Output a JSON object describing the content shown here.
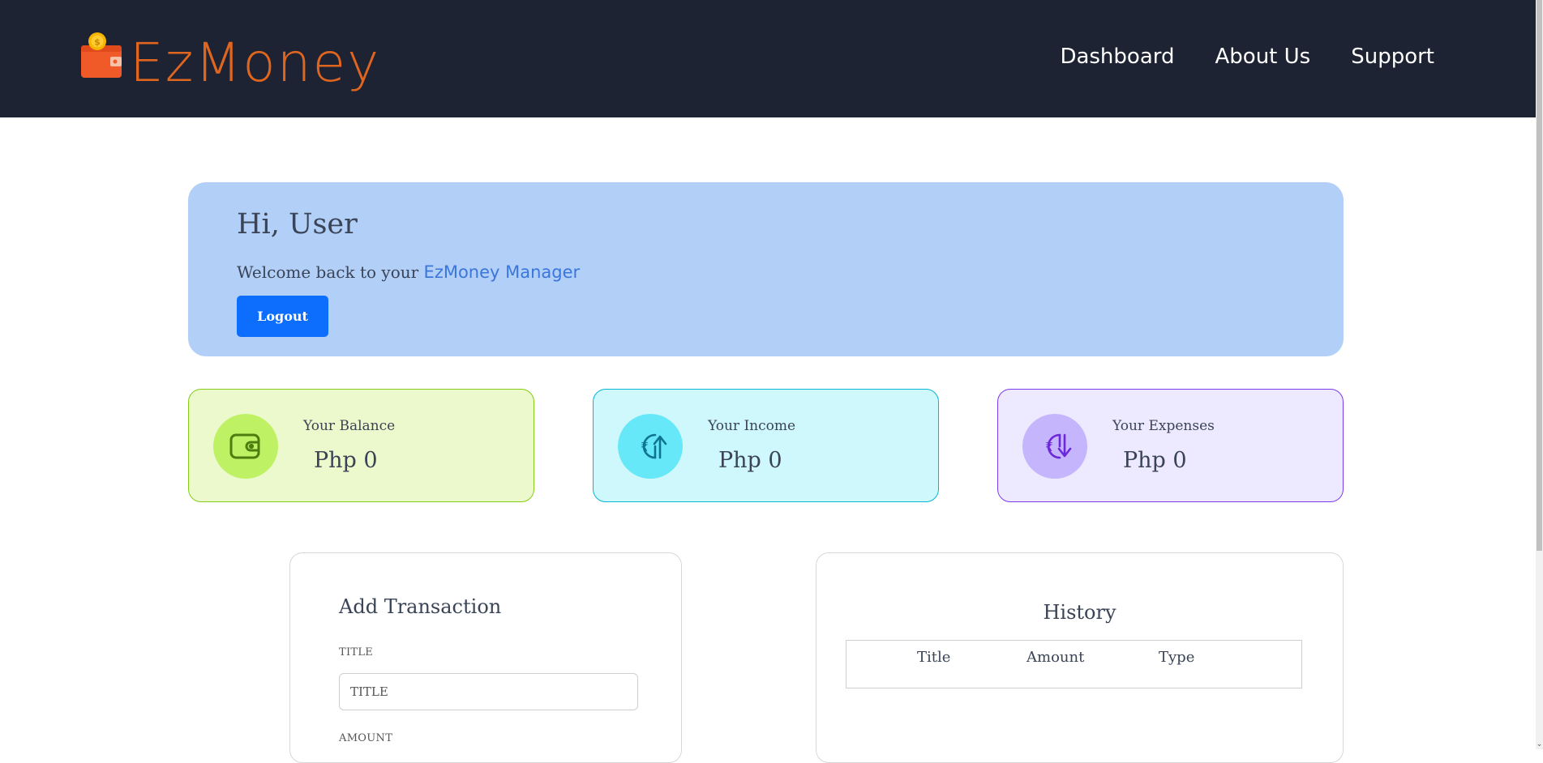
{
  "nav": {
    "brand": "EzMoney",
    "links": [
      "Dashboard",
      "About Us",
      "Support"
    ]
  },
  "welcome": {
    "greeting": "Hi, User",
    "message_prefix": "Welcome back to your ",
    "message_brand": "EzMoney Manager",
    "logout_label": "Logout"
  },
  "stats": {
    "balance": {
      "label": "Your Balance",
      "value": "Php 0",
      "icon": "wallet-icon"
    },
    "income": {
      "label": "Your Income",
      "value": "Php 0",
      "icon": "rupee-up-icon"
    },
    "expenses": {
      "label": "Your Expenses",
      "value": "Php 0",
      "icon": "rupee-down-icon"
    }
  },
  "add_transaction": {
    "title": "Add Transaction",
    "title_field_label": "TITLE",
    "title_field_placeholder": "TITLE",
    "amount_field_label": "AMOUNT"
  },
  "history": {
    "title": "History",
    "columns": [
      "Title",
      "Amount",
      "Type"
    ]
  },
  "colors": {
    "navbar": "#1d2333",
    "brand": "#e0661f",
    "welcome_bg": "#b2cff7",
    "logout_button": "#0d6efd",
    "balance_bg": "#ecf9cc",
    "income_bg": "#cff8fc",
    "expenses_bg": "#ede9fe"
  }
}
